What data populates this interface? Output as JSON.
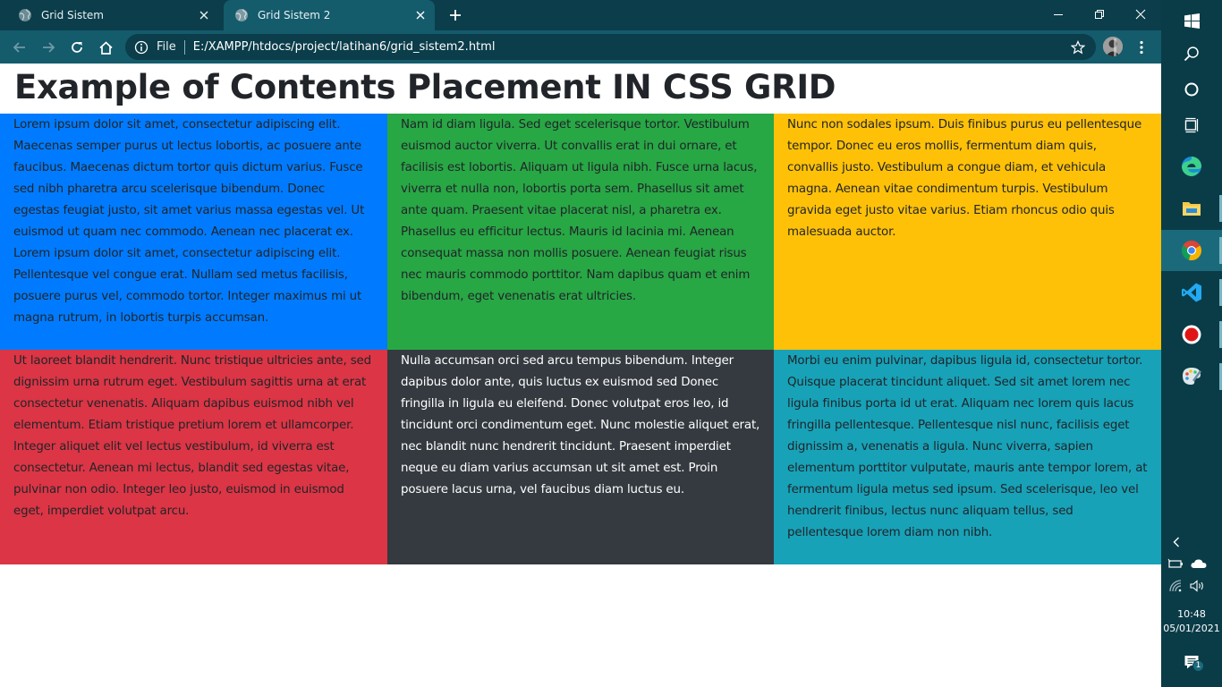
{
  "browser": {
    "tabs": [
      {
        "title": "Grid Sistem",
        "active": false
      },
      {
        "title": "Grid Sistem 2",
        "active": true
      }
    ],
    "address": {
      "scheme": "File",
      "url": "E:/XAMPP/htdocs/project/latihan6/grid_sistem2.html"
    }
  },
  "page": {
    "title": "Example of Contents Placement IN CSS GRID",
    "cells": [
      {
        "bg": "#007bff",
        "color": "#212529",
        "text": "Lorem ipsum dolor sit amet, consectetur adipiscing elit. Maecenas semper purus ut lectus lobortis, ac posuere ante faucibus. Maecenas dictum tortor quis dictum varius. Fusce sed nibh pharetra arcu scelerisque bibendum. Donec egestas feugiat justo, sit amet varius massa egestas vel. Ut euismod ut quam nec commodo. Aenean nec placerat ex. Lorem ipsum dolor sit amet, consectetur adipiscing elit. Pellentesque vel congue erat. Nullam sed metus facilisis, posuere purus vel, commodo tortor. Integer maximus mi ut magna rutrum, in lobortis turpis accumsan."
      },
      {
        "bg": "#28a745",
        "color": "#212529",
        "text": "Nam id diam ligula. Sed eget scelerisque tortor. Vestibulum euismod auctor viverra. Ut convallis erat in dui ornare, et facilisis est lobortis. Aliquam ut ligula nibh. Fusce urna lacus, viverra et nulla non, lobortis porta sem. Phasellus sit amet ante quam. Praesent vitae placerat nisl, a pharetra ex. Phasellus eu efficitur lectus. Mauris id lacinia mi. Aenean consequat massa non mollis posuere. Aenean feugiat risus nec mauris commodo porttitor. Nam dapibus quam et enim bibendum, eget venenatis erat ultricies."
      },
      {
        "bg": "#ffc107",
        "color": "#212529",
        "text": "Nunc non sodales ipsum. Duis finibus purus eu pellentesque tempor. Donec eu eros mollis, fermentum diam quis, convallis justo. Vestibulum a congue diam, et vehicula magna. Aenean vitae condimentum turpis. Vestibulum gravida eget justo vitae varius. Etiam rhoncus odio quis malesuada auctor."
      },
      {
        "bg": "#dc3545",
        "color": "#212529",
        "text": "Ut laoreet blandit hendrerit. Nunc tristique ultricies ante, sed dignissim urna rutrum eget. Vestibulum sagittis urna at erat consectetur venenatis. Aliquam dapibus euismod nibh vel elementum. Etiam tristique pretium lorem et ullamcorper. Integer aliquet elit vel lectus vestibulum, id viverra est consectetur. Aenean mi lectus, blandit sed egestas vitae, pulvinar non odio. Integer leo justo, euismod in euismod eget, imperdiet volutpat arcu."
      },
      {
        "bg": "#343a40",
        "color": "#ffffff",
        "text": "Nulla accumsan orci sed arcu tempus bibendum. Integer dapibus dolor ante, quis luctus ex euismod sed Donec fringilla in ligula eu eleifend. Donec volutpat eros leo, id tincidunt orci condimentum eget. Nunc molestie aliquet erat, nec blandit nunc hendrerit tincidunt. Praesent imperdiet neque eu diam varius accumsan ut sit amet est. Proin posuere lacus urna, vel faucibus diam luctus eu."
      },
      {
        "bg": "#17a2b8",
        "color": "#212529",
        "text": "Morbi eu enim pulvinar, dapibus ligula id, consectetur tortor. Quisque placerat tincidunt aliquet. Sed sit amet lorem nec ligula finibus porta id ut erat. Aliquam nec lorem quis lacus fringilla pellentesque. Pellentesque nisl nunc, facilisis eget dignissim a, venenatis a ligula. Nunc viverra, sapien elementum porttitor vulputate, mauris ante tempor lorem, at fermentum ligula metus sed ipsum. Sed scelerisque, leo vel hendrerit finibus, lectus nunc aliquam tellus, sed pellentesque lorem diam non nibh."
      }
    ]
  },
  "taskbar": {
    "time": "10:48",
    "date": "05/01/2021",
    "notification_count": "1",
    "pinned": [
      "start-icon",
      "search-icon",
      "cortana-icon",
      "task-view-icon",
      "edge-icon",
      "file-explorer-icon",
      "chrome-icon",
      "vscode-icon",
      "record-icon",
      "paint-icon"
    ]
  },
  "colors": {
    "tabstrip": "#0b3d4a",
    "toolbar": "#145b6c",
    "taskbar": "#0a3c48"
  }
}
